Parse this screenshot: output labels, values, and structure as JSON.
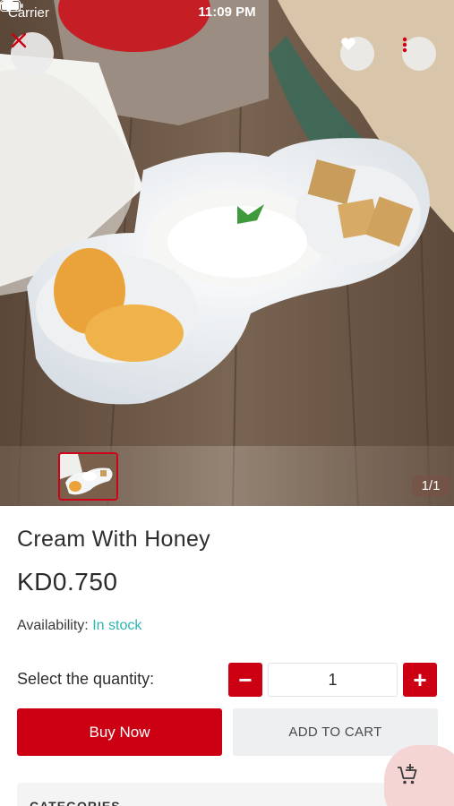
{
  "status_bar": {
    "carrier": "Carrier",
    "time": "11:09 PM"
  },
  "gallery": {
    "counter": "1/1",
    "active_index": 1,
    "total": 1
  },
  "product": {
    "title": "Cream With Honey",
    "price": "KD0.750",
    "availability_label": "Availability:",
    "availability_value": "In stock"
  },
  "quantity": {
    "label": "Select the quantity:",
    "value": "1",
    "minus": "−",
    "plus": "+"
  },
  "actions": {
    "buy_now": "Buy Now",
    "add_to_cart": "ADD TO CART"
  },
  "sections": {
    "categories": "CATEGORIES"
  },
  "colors": {
    "primary": "#cc0012",
    "stock": "#2bb5b0",
    "fab_bg": "#f5d4d4"
  },
  "icons": {
    "close": "close-icon",
    "favorite": "heart-icon",
    "more": "more-vertical-icon",
    "cart": "add-to-cart-icon",
    "wifi": "wifi-icon",
    "battery": "battery-icon"
  }
}
